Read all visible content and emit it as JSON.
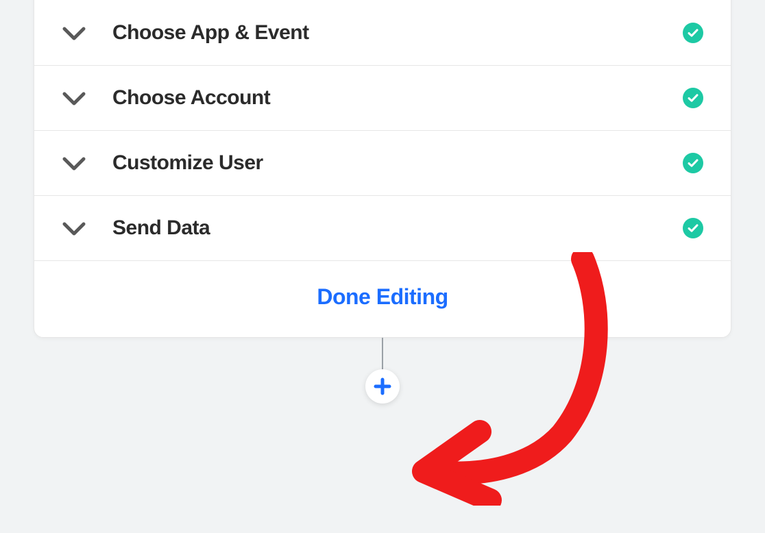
{
  "colors": {
    "accent_blue": "#1b6dff",
    "success_green": "#1dc9a4",
    "annotation_red": "#ef1c1c",
    "chevron_grey": "#595959"
  },
  "steps": [
    {
      "id": "choose-app-event",
      "label": "Choose App & Event",
      "completed": true
    },
    {
      "id": "choose-account",
      "label": "Choose Account",
      "completed": true
    },
    {
      "id": "customize-user",
      "label": "Customize User",
      "completed": true
    },
    {
      "id": "send-data",
      "label": "Send Data",
      "completed": true
    }
  ],
  "footer": {
    "done_label": "Done Editing"
  },
  "icons": {
    "add_step": "plus-icon"
  }
}
